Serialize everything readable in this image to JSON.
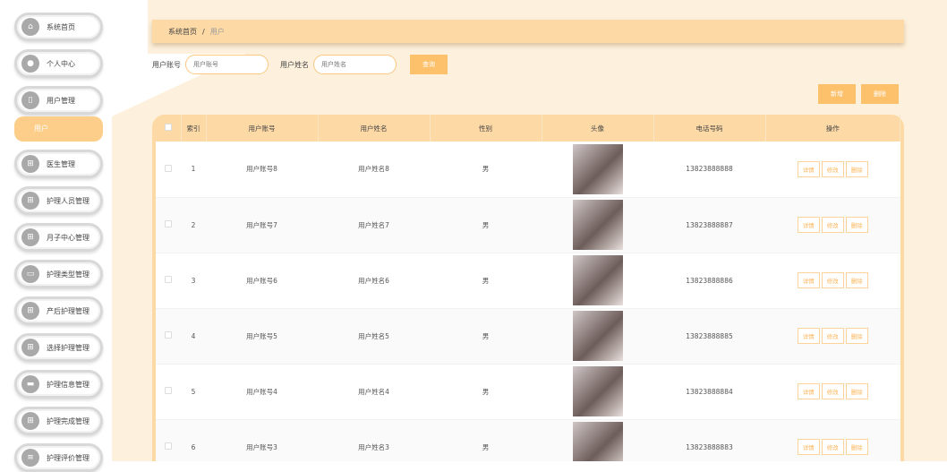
{
  "sidebar": {
    "items": [
      {
        "label": "系统首页",
        "icon": "home-icon",
        "glyph": "⌂"
      },
      {
        "label": "个人中心",
        "icon": "user-icon",
        "glyph": "●"
      },
      {
        "label": "用户管理",
        "icon": "document-icon",
        "glyph": "▯"
      },
      {
        "label": "医生管理",
        "icon": "grid-icon",
        "glyph": "⊞"
      },
      {
        "label": "护理人员管理",
        "icon": "grid-icon",
        "glyph": "⊞"
      },
      {
        "label": "月子中心管理",
        "icon": "grid-icon",
        "glyph": "⊞"
      },
      {
        "label": "护理类型管理",
        "icon": "monitor-icon",
        "glyph": "▭"
      },
      {
        "label": "产后护理管理",
        "icon": "grid-icon",
        "glyph": "⊞"
      },
      {
        "label": "选择护理管理",
        "icon": "grid-icon",
        "glyph": "⊞"
      },
      {
        "label": "护理信息管理",
        "icon": "briefcase-icon",
        "glyph": "▬"
      },
      {
        "label": "护理完成管理",
        "icon": "grid-icon",
        "glyph": "⊞"
      },
      {
        "label": "护理评价管理",
        "icon": "list-icon",
        "glyph": "≡"
      }
    ],
    "active_sub": "用户"
  },
  "breadcrumb": {
    "home": "系统首页",
    "sep": "/",
    "current": "用户"
  },
  "search": {
    "account_label": "用户账号",
    "account_placeholder": "用户账号",
    "name_label": "用户姓名",
    "name_placeholder": "用户姓名",
    "query": "查询"
  },
  "toolbar": {
    "add": "新增",
    "delete": "删除"
  },
  "table": {
    "headers": [
      "索引",
      "用户账号",
      "用户姓名",
      "性别",
      "头像",
      "电话号码",
      "操作"
    ],
    "rows": [
      {
        "index": "1",
        "account": "用户账号8",
        "name": "用户姓名8",
        "gender": "男",
        "phone": "13823888888"
      },
      {
        "index": "2",
        "account": "用户账号7",
        "name": "用户姓名7",
        "gender": "男",
        "phone": "13823888887"
      },
      {
        "index": "3",
        "account": "用户账号6",
        "name": "用户姓名6",
        "gender": "男",
        "phone": "13823888886"
      },
      {
        "index": "4",
        "account": "用户账号5",
        "name": "用户姓名5",
        "gender": "男",
        "phone": "13823888885"
      },
      {
        "index": "5",
        "account": "用户账号4",
        "name": "用户姓名4",
        "gender": "男",
        "phone": "13823888884"
      },
      {
        "index": "6",
        "account": "用户账号3",
        "name": "用户姓名3",
        "gender": "男",
        "phone": "13823888883"
      }
    ],
    "actions": {
      "detail": "详情",
      "edit": "修改",
      "delete": "删除"
    }
  },
  "colors": {
    "accent": "#fdc16c",
    "header": "#fdd9a6",
    "bg": "#fdf0dc"
  }
}
